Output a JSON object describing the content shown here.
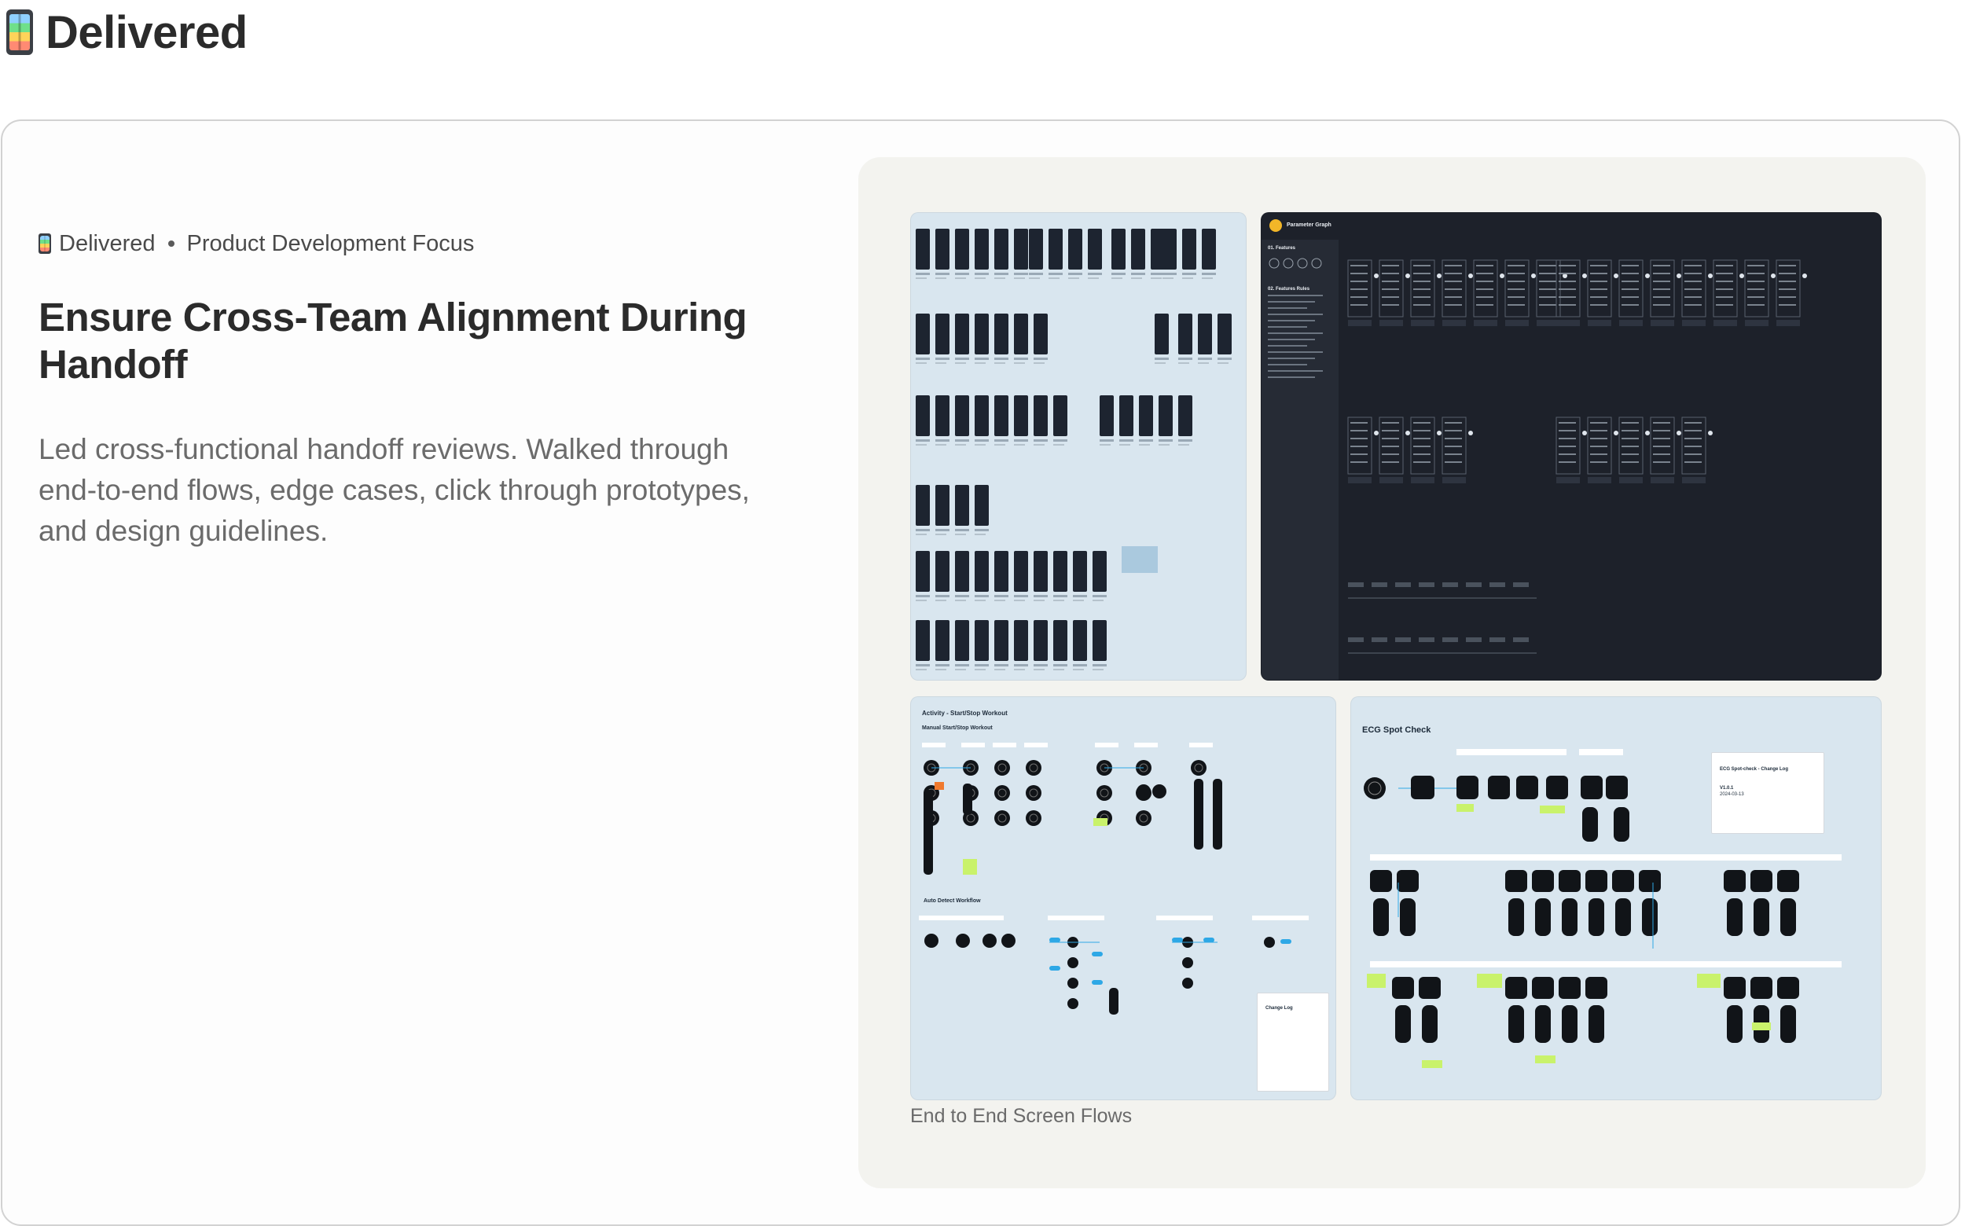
{
  "page": {
    "title": "Delivered",
    "icon": "mobile-phone-icon"
  },
  "card": {
    "eyebrow_status": "Delivered",
    "eyebrow_focus": "Product Development Focus",
    "heading": "Ensure Cross-Team Alignment During Handoff",
    "description": "Led cross-functional handoff reviews. Walked through end-to-end flows, edge cases, click through prototypes, and design guidelines."
  },
  "gallery": {
    "caption": "End to End Screen Flows",
    "thumbnails": {
      "parameter_graph": {
        "title": "Parameter Graph",
        "section_features": "01. Features",
        "section_rules": "02. Features Rules"
      },
      "activity": {
        "title": "Activity - Start/Stop Workout",
        "subtitle_manual": "Manual Start/Stop Workout",
        "subtitle_auto": "Auto Detect Workflow",
        "change_log": "Change Log"
      },
      "ecg": {
        "title": "ECG Spot Check",
        "change_log": "ECG Spot-check - Change Log",
        "version": "V1.0.1",
        "date": "2024-03-13"
      }
    }
  },
  "colors": {
    "gallery_bg": "#f3f3ef",
    "thumb_light": "#d9e6ef",
    "thumb_dark": "#1d212a",
    "accent_blue": "#2ea8e6",
    "sticky_green": "#c9f26b"
  }
}
